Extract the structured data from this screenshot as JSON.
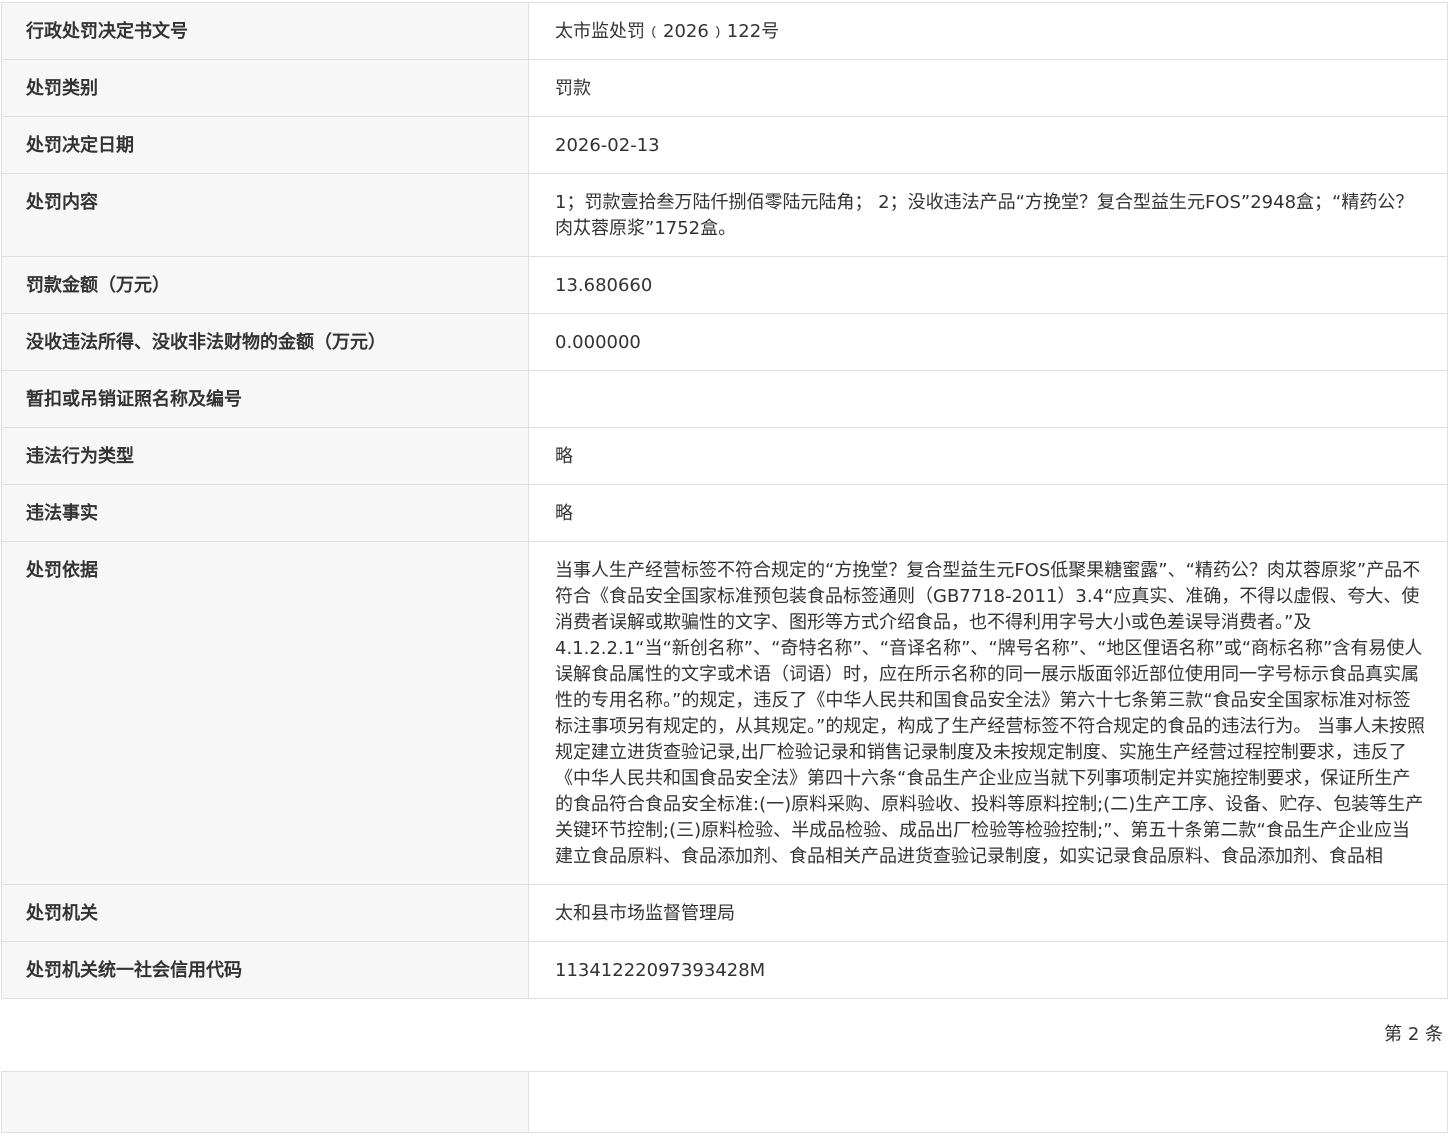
{
  "record": [
    {
      "label": "行政处罚决定书文号",
      "value": "太市监处罚﹙2026﹚122号"
    },
    {
      "label": "处罚类别",
      "value": "罚款"
    },
    {
      "label": "处罚决定日期",
      "value": "2026-02-13"
    },
    {
      "label": "处罚内容",
      "value": "1；罚款壹拾叁万陆仟捌佰零陆元陆角； 2；没收违法产品“方挽堂？复合型益生元FOS”2948盒；“精药公？肉苁蓉原浆”1752盒。"
    },
    {
      "label": "罚款金额（万元）",
      "value": "13.680660"
    },
    {
      "label": "没收违法所得、没收非法财物的金额（万元）",
      "value": "0.000000"
    },
    {
      "label": "暂扣或吊销证照名称及编号",
      "value": ""
    },
    {
      "label": "违法行为类型",
      "value": "略"
    },
    {
      "label": "违法事实",
      "value": "略"
    },
    {
      "label": "处罚依据",
      "value": "当事人生产经营标签不符合规定的“方挽堂？复合型益生元FOS低聚果糖蜜露”、“精药公？肉苁蓉原浆”产品不符合《食品安全国家标准预包装食品标签通则（GB7718-2011）3.4“应真实、准确，不得以虚假、夸大、使消费者误解或欺骗性的文字、图形等方式介绍食品，也不得利用字号大小或色差误导消费者。”及4.1.2.2.1“当“新创名称”、“奇特名称”、“音译名称”、“牌号名称”、“地区俚语名称”或“商标名称”含有易使人误解食品属性的文字或术语（词语）时，应在所示名称的同一展示版面邻近部位使用同一字号标示食品真实属性的专用名称。”的规定，违反了《中华人民共和国食品安全法》第六十七条第三款“食品安全国家标准对标签标注事项另有规定的，从其规定。”的规定，构成了生产经营标签不符合规定的食品的违法行为。 当事人未按照规定建立进货查验记录,出厂检验记录和销售记录制度及未按规定制度、实施生产经营过程控制要求，违反了《中华人民共和国食品安全法》第四十六条“食品生产企业应当就下列事项制定并实施控制要求，保证所生产的食品符合食品安全标准:(一)原料采购、原料验收、投料等原料控制;(二)生产工序、设备、贮存、包装等生产关键环节控制;(三)原料检验、半成品检验、成品出厂检验等检验控制;”、第五十条第二款“食品生产企业应当建立食品原料、食品添加剂、食品相关产品进货查验记录制度，如实记录食品原料、食品添加剂、食品相"
    },
    {
      "label": "处罚机关",
      "value": "太和县市场监督管理局"
    },
    {
      "label": "处罚机关统一社会信用代码",
      "value": "11341222097393428M"
    }
  ],
  "pager": "第 2 条"
}
